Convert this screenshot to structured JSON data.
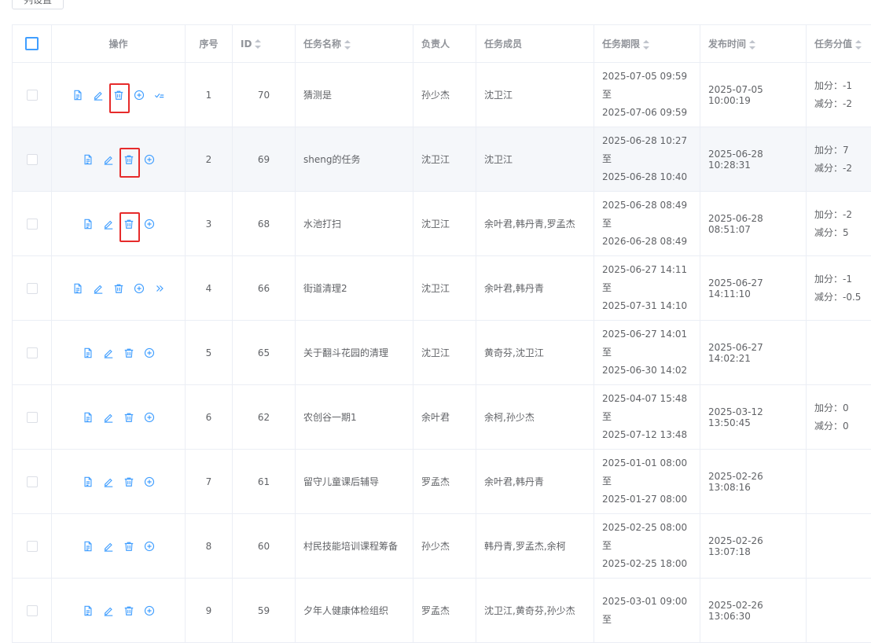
{
  "toolbar": {
    "column_settings": "列设置"
  },
  "table": {
    "headers": {
      "ops": "操作",
      "seq": "序号",
      "id": "ID",
      "name": "任务名称",
      "owner": "负责人",
      "members": "任务成员",
      "period": "任务期限",
      "published": "发布时间",
      "score": "任务分值"
    },
    "period_sep": "至",
    "add_label": "加分：",
    "sub_label": "减分：",
    "rows": [
      {
        "seq": "1",
        "id": "70",
        "name": "猜测是",
        "owner": "孙少杰",
        "members": "沈卫江",
        "start": "2025-07-05 09:59",
        "end": "2025-07-06 09:59",
        "published": "2025-07-05 10:00:19",
        "add": "-1",
        "sub": "-2"
      },
      {
        "seq": "2",
        "id": "69",
        "name": "sheng的任务",
        "owner": "沈卫江",
        "members": "沈卫江",
        "start": "2025-06-28 10:27",
        "end": "2025-06-28 10:40",
        "published": "2025-06-28 10:28:31",
        "add": "7",
        "sub": "-2"
      },
      {
        "seq": "3",
        "id": "68",
        "name": "水池打扫",
        "owner": "沈卫江",
        "members": "余叶君,韩丹青,罗孟杰",
        "start": "2025-06-28 08:49",
        "end": "2026-06-28 08:49",
        "published": "2025-06-28 08:51:07",
        "add": "-2",
        "sub": "5"
      },
      {
        "seq": "4",
        "id": "66",
        "name": "街道清理2",
        "owner": "沈卫江",
        "members": "余叶君,韩丹青",
        "start": "2025-06-27 14:11",
        "end": "2025-07-31 14:10",
        "published": "2025-06-27 14:11:10",
        "add": "-1",
        "sub": "-0.5"
      },
      {
        "seq": "5",
        "id": "65",
        "name": "关于翻斗花园的清理",
        "owner": "沈卫江",
        "members": "黄奇芬,沈卫江",
        "start": "2025-06-27 14:01",
        "end": "2025-06-30 14:02",
        "published": "2025-06-27 14:02:21",
        "add": "",
        "sub": ""
      },
      {
        "seq": "6",
        "id": "62",
        "name": "农创谷一期1",
        "owner": "余叶君",
        "members": "余柯,孙少杰",
        "start": "2025-04-07 15:48",
        "end": "2025-07-12 13:48",
        "published": "2025-03-12 13:50:45",
        "add": "0",
        "sub": "0"
      },
      {
        "seq": "7",
        "id": "61",
        "name": "留守儿童课后辅导",
        "owner": "罗孟杰",
        "members": "余叶君,韩丹青",
        "start": "2025-01-01 08:00",
        "end": "2025-01-27 08:00",
        "published": "2025-02-26 13:08:16",
        "add": "",
        "sub": ""
      },
      {
        "seq": "8",
        "id": "60",
        "name": "村民技能培训课程筹备",
        "owner": "孙少杰",
        "members": "韩丹青,罗孟杰,余柯",
        "start": "2025-02-25 08:00",
        "end": "2025-02-25 18:00",
        "published": "2025-02-26 13:07:18",
        "add": "",
        "sub": ""
      },
      {
        "seq": "9",
        "id": "59",
        "name": "夕年人健康体检组织",
        "owner": "罗孟杰",
        "members": "沈卫江,黄奇芬,孙少杰",
        "start": "2025-03-01 09:00",
        "end": "",
        "published": "2025-02-26 13:06:30",
        "add": "",
        "sub": ""
      }
    ]
  },
  "colors": {
    "accent": "#409eff",
    "highlight": "#e62b2b",
    "border": "#ebeef5"
  }
}
